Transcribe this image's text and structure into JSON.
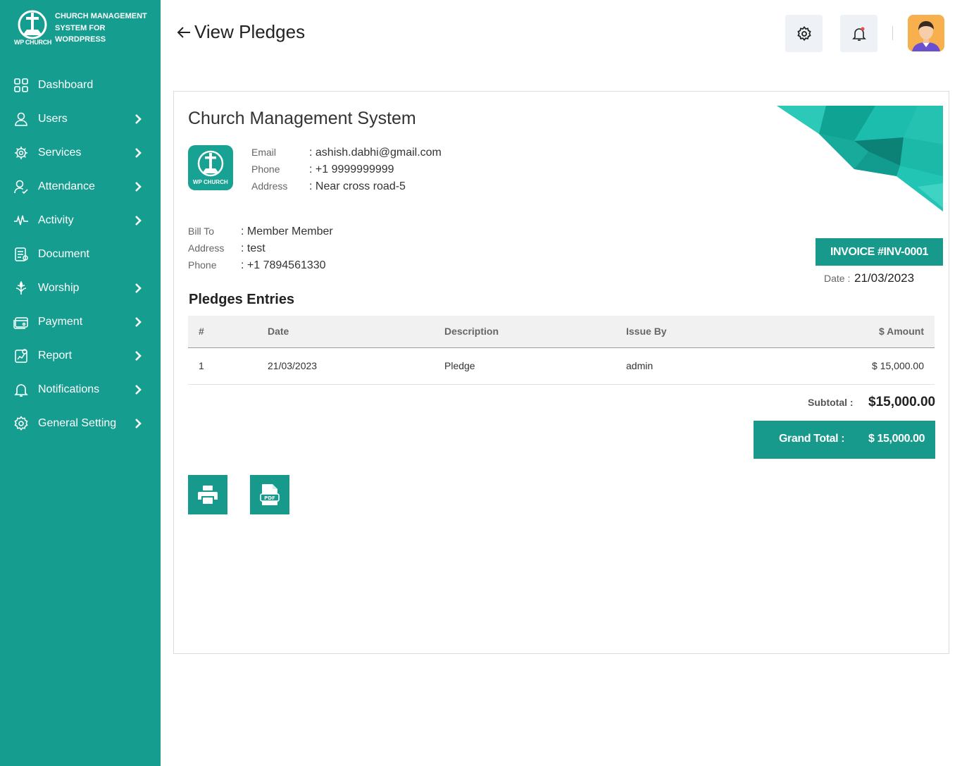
{
  "brand": {
    "logo_text": "WP CHURCH",
    "lines": [
      "CHURCH MANAGEMENT",
      "SYSTEM FOR",
      "WORDPRESS"
    ]
  },
  "sidebar": {
    "items": [
      {
        "label": "Dashboard",
        "icon": "dashboard-icon",
        "has_chevron": false
      },
      {
        "label": "Users",
        "icon": "user-icon",
        "has_chevron": true
      },
      {
        "label": "Services",
        "icon": "services-icon",
        "has_chevron": true
      },
      {
        "label": "Attendance",
        "icon": "attendance-icon",
        "has_chevron": true
      },
      {
        "label": "Activity",
        "icon": "activity-icon",
        "has_chevron": true
      },
      {
        "label": "Document",
        "icon": "document-icon",
        "has_chevron": false
      },
      {
        "label": "Worship",
        "icon": "worship-icon",
        "has_chevron": true
      },
      {
        "label": "Payment",
        "icon": "payment-icon",
        "has_chevron": true
      },
      {
        "label": "Report",
        "icon": "report-icon",
        "has_chevron": true
      },
      {
        "label": "Notifications",
        "icon": "bell-icon",
        "has_chevron": true
      },
      {
        "label": "General Setting",
        "icon": "gear-icon",
        "has_chevron": true
      }
    ]
  },
  "header": {
    "title": "View Pledges"
  },
  "invoice": {
    "org_name": "Church Management System",
    "logo_text": "WP CHURCH",
    "org": {
      "email_label": "Email",
      "email": ": ashish.dabhi@gmail.com",
      "phone_label": "Phone",
      "phone": ": +1 9999999999",
      "address_label": "Address",
      "address": ": Near cross road-5"
    },
    "bill": {
      "bill_to_label": "Bill To",
      "bill_to": ": Member Member",
      "address_label": "Address",
      "address": ": test",
      "phone_label": "Phone",
      "phone": ": +1 7894561330"
    },
    "invoice_no": "INVOICE #INV-0001",
    "date_label": "Date :",
    "date": "21/03/2023",
    "section_title": "Pledges Entries",
    "columns": [
      "#",
      "Date",
      "Description",
      "Issue By",
      "$ Amount"
    ],
    "rows": [
      [
        "1",
        "21/03/2023",
        "Pledge",
        "admin",
        "$ 15,000.00"
      ]
    ],
    "subtotal_label": "Subtotal :",
    "subtotal": "$15,000.00",
    "grand_total_label": "Grand Total :",
    "grand_total": "$ 15,000.00"
  },
  "colors": {
    "sidebar": "#159d90",
    "accent": "#17998c"
  }
}
